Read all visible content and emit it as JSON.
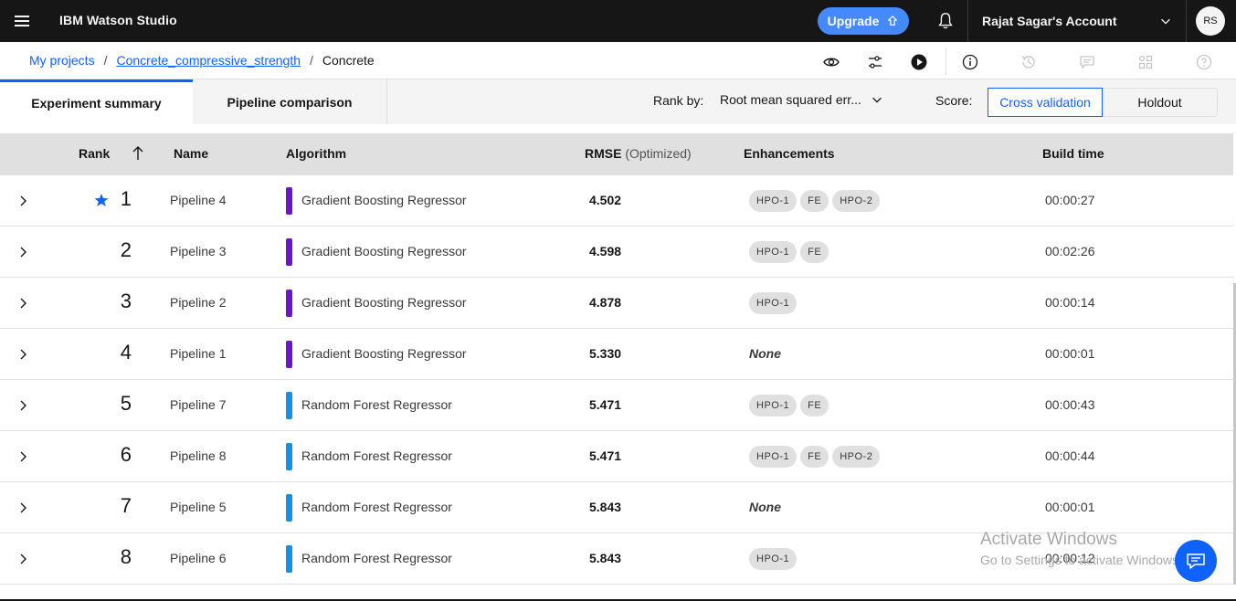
{
  "header": {
    "brand": "IBM Watson Studio",
    "upgrade_label": "Upgrade",
    "account_name": "Rajat Sagar's Account",
    "avatar_initials": "RS"
  },
  "breadcrumb": {
    "items": [
      "My projects",
      "Concrete_compressive_strength"
    ],
    "current": "Concrete"
  },
  "tabs": [
    "Experiment summary",
    "Pipeline comparison"
  ],
  "controls": {
    "rank_by_label": "Rank by:",
    "rank_by_value": "Root mean squared err...",
    "score_label": "Score:",
    "score_options": [
      "Cross validation",
      "Holdout"
    ]
  },
  "table": {
    "columns": {
      "rank": "Rank",
      "name": "Name",
      "algorithm": "Algorithm",
      "rmse": "RMSE",
      "rmse_sub": "(Optimized)",
      "enhancements": "Enhancements",
      "build_time": "Build time"
    },
    "rows": [
      {
        "rank": "1",
        "name": "Pipeline 4",
        "algorithm": "Gradient Boosting Regressor",
        "rmse": "4.502",
        "enhancements": [
          "HPO-1",
          "FE",
          "HPO-2"
        ],
        "build_time": "00:00:27",
        "starred": true
      },
      {
        "rank": "2",
        "name": "Pipeline 3",
        "algorithm": "Gradient Boosting Regressor",
        "rmse": "4.598",
        "enhancements": [
          "HPO-1",
          "FE"
        ],
        "build_time": "00:02:26"
      },
      {
        "rank": "3",
        "name": "Pipeline 2",
        "algorithm": "Gradient Boosting Regressor",
        "rmse": "4.878",
        "enhancements": [
          "HPO-1"
        ],
        "build_time": "00:00:14"
      },
      {
        "rank": "4",
        "name": "Pipeline 1",
        "algorithm": "Gradient Boosting Regressor",
        "rmse": "5.330",
        "enhancements": [],
        "none_label": "None",
        "build_time": "00:00:01"
      },
      {
        "rank": "5",
        "name": "Pipeline 7",
        "algorithm": "Random Forest Regressor",
        "rmse": "5.471",
        "enhancements": [
          "HPO-1",
          "FE"
        ],
        "build_time": "00:00:43"
      },
      {
        "rank": "6",
        "name": "Pipeline 8",
        "algorithm": "Random Forest Regressor",
        "rmse": "5.471",
        "enhancements": [
          "HPO-1",
          "FE",
          "HPO-2"
        ],
        "build_time": "00:00:44"
      },
      {
        "rank": "7",
        "name": "Pipeline 5",
        "algorithm": "Random Forest Regressor",
        "rmse": "5.843",
        "enhancements": [],
        "none_label": "None",
        "build_time": "00:00:01"
      },
      {
        "rank": "8",
        "name": "Pipeline 6",
        "algorithm": "Random Forest Regressor",
        "rmse": "5.843",
        "enhancements": [
          "HPO-1"
        ],
        "build_time": "00:00:12"
      }
    ]
  },
  "algorithm_colors": {
    "Gradient Boosting Regressor": "#6f12d0",
    "Random Forest Regressor": "#1192e8"
  },
  "watermark": {
    "line1": "Activate Windows",
    "line2": "Go to Settings to activate Windows."
  }
}
